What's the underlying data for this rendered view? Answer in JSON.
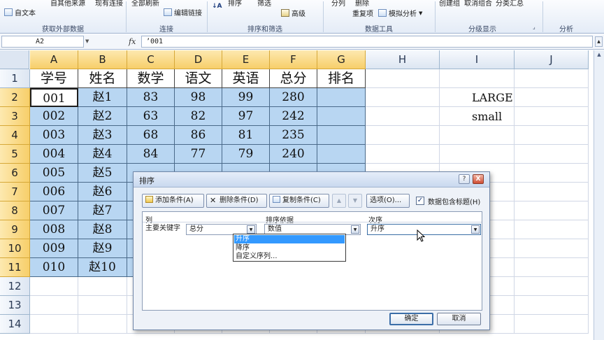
{
  "ribbon": {
    "buttons": {
      "from_text": "自文本",
      "from_other": "自其他来源",
      "existing": "现有连接",
      "refresh_all": "全部刷新",
      "edit_links": "编辑链接",
      "sort": "排序",
      "filter": "筛选",
      "advanced": "高级",
      "split": "分列",
      "delete_dup": "删除",
      "dup_items": "重复项",
      "what_if": "模拟分析",
      "group": "创建组",
      "ungroup": "取消组合",
      "subtotal": "分类汇总"
    },
    "groups": {
      "external": "获取外部数据",
      "connections": "连接",
      "sort_filter": "排序和筛选",
      "data_tools": "数据工具",
      "outline": "分级显示",
      "analysis": "分析"
    }
  },
  "formula_bar": {
    "name_box": "A2",
    "fx": "fx",
    "content": "’001"
  },
  "columns": [
    "A",
    "B",
    "C",
    "D",
    "E",
    "F",
    "G",
    "H",
    "I",
    "J"
  ],
  "rows": [
    "1",
    "2",
    "3",
    "4",
    "5",
    "6",
    "7",
    "8",
    "9",
    "10",
    "11",
    "12",
    "13",
    "14"
  ],
  "table": {
    "headers": [
      "学号",
      "姓名",
      "数学",
      "语文",
      "英语",
      "总分",
      "排名"
    ],
    "data": [
      [
        "001",
        "赵1",
        "83",
        "98",
        "99",
        "280",
        ""
      ],
      [
        "002",
        "赵2",
        "63",
        "82",
        "97",
        "242",
        ""
      ],
      [
        "003",
        "赵3",
        "68",
        "86",
        "81",
        "235",
        ""
      ],
      [
        "004",
        "赵4",
        "84",
        "77",
        "79",
        "240",
        ""
      ],
      [
        "005",
        "赵5",
        "",
        "",
        "",
        "",
        ""
      ],
      [
        "006",
        "赵6",
        "",
        "",
        "",
        "",
        ""
      ],
      [
        "007",
        "赵7",
        "",
        "",
        "",
        "",
        ""
      ],
      [
        "008",
        "赵8",
        "",
        "",
        "",
        "",
        ""
      ],
      [
        "009",
        "赵9",
        "",
        "",
        "",
        "",
        ""
      ],
      [
        "010",
        "赵10",
        "",
        "",
        "",
        "",
        ""
      ]
    ]
  },
  "side_cells": {
    "i2": "LARGE",
    "i3": "small"
  },
  "dialog": {
    "title": "排序",
    "help": "?",
    "close": "X",
    "add_level": "添加条件(A)",
    "delete_level": "删除条件(D)",
    "copy_level": "复制条件(C)",
    "up": "▲",
    "down": "▼",
    "options": "选项(O)...",
    "header_check": "✓",
    "header_label": "数据包含标题(H)",
    "col_header": "列",
    "sort_on_header": "排序依据",
    "order_header": "次序",
    "row_label": "主要关键字",
    "column_value": "总分",
    "sort_on_value": "数值",
    "order_value": "升序",
    "order_options": [
      "升序",
      "降序",
      "自定义序列..."
    ],
    "ok": "确定",
    "cancel": "取消"
  }
}
